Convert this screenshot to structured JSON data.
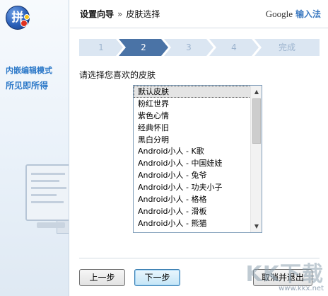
{
  "sidebar": {
    "logo_char": "拼",
    "features": [
      "内嵌编辑模式",
      "所见即所得"
    ]
  },
  "header": {
    "title": "设置向导",
    "separator": "»",
    "subtitle": "皮肤选择",
    "brand": "Google",
    "product": "输入法"
  },
  "steps": [
    {
      "label": "1",
      "active": false
    },
    {
      "label": "2",
      "active": true
    },
    {
      "label": "3",
      "active": false
    },
    {
      "label": "4",
      "active": false
    },
    {
      "label": "完成",
      "active": false
    }
  ],
  "content": {
    "prompt": "请选择您喜欢的皮肤",
    "skins": [
      "默认皮肤",
      "粉红世界",
      "紫色心情",
      "经典怀旧",
      "黑白分明",
      "Android小人 - K歌",
      "Android小人 - 中国娃娃",
      "Android小人 - 兔爷",
      "Android小人 - 功夫小子",
      "Android小人 - 格格",
      "Android小人 - 滑板",
      "Android小人 - 熊猫"
    ],
    "selected_index": 0
  },
  "buttons": {
    "prev": "上一步",
    "next": "下一步",
    "cancel": "取消并退出"
  },
  "watermark": {
    "text": "KK下载",
    "url": "www.kkx.net"
  },
  "colors": {
    "accent": "#3a78c0",
    "step_active": "#4a73a6",
    "step_inactive": "#dbe6f2"
  }
}
